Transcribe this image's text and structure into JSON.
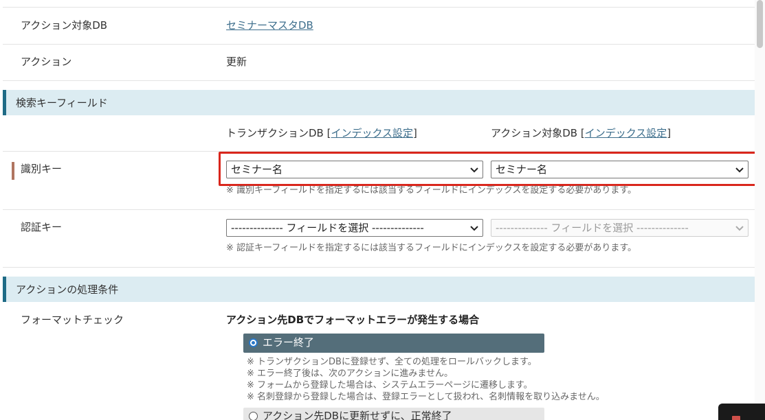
{
  "rows": {
    "target_db": {
      "label": "アクション対象DB",
      "value": "セミナーマスタDB"
    },
    "action": {
      "label": "アクション",
      "value": "更新"
    }
  },
  "search_section": {
    "title": "検索キーフィールド",
    "col_transaction": {
      "text": "トランザクションDB [",
      "link": "インデックス設定",
      "close": "]"
    },
    "col_target": {
      "text": "アクション対象DB [",
      "link": "インデックス設定",
      "close": "]"
    },
    "identify_key": {
      "label": "識別キー",
      "select_left": "セミナー名",
      "select_right": "セミナー名",
      "note": "※ 識別キーフィールドを指定するには該当するフィールドにインデックスを設定する必要があります。"
    },
    "auth_key": {
      "label": "認証キー",
      "select_left": "-------------- フィールドを選択 --------------",
      "select_right": "-------------- フィールドを選択 --------------",
      "note": "※ 認証キーフィールドを指定するには該当するフィールドにインデックスを設定する必要があります。"
    }
  },
  "condition_section": {
    "title": "アクションの処理条件",
    "format_check": {
      "label": "フォーマットチェック",
      "subhead": "アクション先DBでフォーマットエラーが発生する場合",
      "option_selected": "エラー終了",
      "notes": [
        "※ トランザクションDBに登録せず、全ての処理をロールバックします。",
        "※ エラー終了後は、次のアクションに進みません。",
        "※ フォームから登録した場合は、システムエラーページに遷移します。",
        "※ 名刺登録から登録した場合は、登録エラーとして扱われ、名刺情報を取り込みません。"
      ],
      "option_other": "アクション先DBに更新せずに、正常終了"
    }
  },
  "icons": {
    "dropdown": "chevron-down-icon",
    "radio": "radio-button-icon"
  },
  "colors": {
    "section_bg": "#dcecf2",
    "section_accent": "#1f6b86",
    "highlight": "#d9261c",
    "selected_option_bg": "#546e7a",
    "required_bar": "#b07560",
    "link": "#3d6e8c"
  }
}
